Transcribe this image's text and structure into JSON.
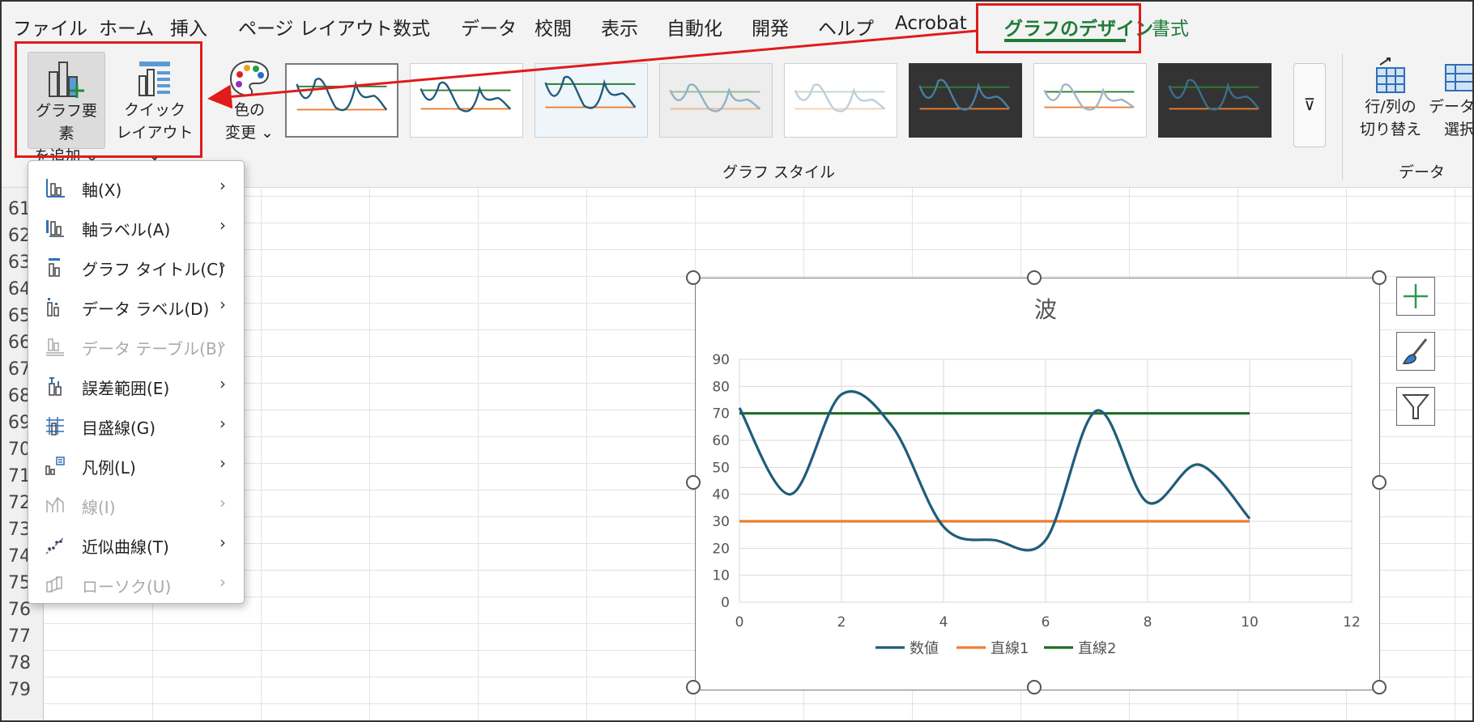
{
  "menubar": {
    "tabs": [
      {
        "label": "ファイル",
        "active": false
      },
      {
        "label": "ホーム",
        "active": false
      },
      {
        "label": "挿入",
        "active": false
      },
      {
        "label": "ページ レイアウト",
        "active": false
      },
      {
        "label": "数式",
        "active": false
      },
      {
        "label": "データ",
        "active": false
      },
      {
        "label": "校閲",
        "active": false
      },
      {
        "label": "表示",
        "active": false
      },
      {
        "label": "自動化",
        "active": false
      },
      {
        "label": "開発",
        "active": false
      },
      {
        "label": "ヘルプ",
        "active": false
      },
      {
        "label": "Acrobat",
        "active": false
      },
      {
        "label": "グラフのデザイン",
        "active": true
      },
      {
        "label": "書式",
        "active": false
      }
    ]
  },
  "ribbon": {
    "add_element": {
      "line1": "グラフ要素",
      "line2": "を追加 ⌄"
    },
    "quick_layout": {
      "line1": "クイック",
      "line2": "レイアウト ⌄"
    },
    "color": {
      "line1": "色の",
      "line2": "変更 ⌄"
    },
    "style_group_label": "グラフ スタイル",
    "switch_rowcol": {
      "line1": "行/列の",
      "line2": "切り替え"
    },
    "select_data": {
      "line1": "データの",
      "line2": "選択"
    },
    "data_group_label": "データ"
  },
  "sheet": {
    "row_numbers": [
      "61",
      "62",
      "63",
      "64",
      "65",
      "66",
      "67",
      "68",
      "69",
      "70",
      "71",
      "72",
      "73",
      "74",
      "75",
      "76",
      "77",
      "78",
      "79"
    ]
  },
  "dropdown": {
    "items": [
      {
        "label": "軸(X)",
        "icon": "axis-icon",
        "enabled": true
      },
      {
        "label": "軸ラベル(A)",
        "icon": "axis-label-icon",
        "enabled": true
      },
      {
        "label": "グラフ タイトル(C)",
        "icon": "chart-title-icon",
        "enabled": true
      },
      {
        "label": "データ ラベル(D)",
        "icon": "data-label-icon",
        "enabled": true
      },
      {
        "label": "データ テーブル(B)",
        "icon": "data-table-icon",
        "enabled": false
      },
      {
        "label": "誤差範囲(E)",
        "icon": "error-bars-icon",
        "enabled": true
      },
      {
        "label": "目盛線(G)",
        "icon": "gridlines-icon",
        "enabled": true
      },
      {
        "label": "凡例(L)",
        "icon": "legend-icon",
        "enabled": true
      },
      {
        "label": "線(I)",
        "icon": "lines-icon",
        "enabled": false
      },
      {
        "label": "近似曲線(T)",
        "icon": "trendline-icon",
        "enabled": true
      },
      {
        "label": "ローソク(U)",
        "icon": "updown-bars-icon",
        "enabled": false
      }
    ]
  },
  "chart_data": {
    "type": "scatter",
    "title": "波",
    "xlim": [
      0,
      12
    ],
    "ylim": [
      0,
      90
    ],
    "x_ticks": [
      "0",
      "2",
      "4",
      "6",
      "8",
      "10",
      "12"
    ],
    "y_ticks": [
      "0",
      "10",
      "20",
      "30",
      "40",
      "50",
      "60",
      "70",
      "80",
      "90"
    ],
    "grid": true,
    "legend_position": "bottom",
    "smooth": true,
    "series": [
      {
        "name": "数値",
        "color": "#1f5c7a",
        "x": [
          0,
          1,
          2,
          3,
          4,
          5,
          6,
          7,
          8,
          9,
          10
        ],
        "y": [
          72,
          40,
          77,
          65,
          28,
          23,
          23,
          71,
          37,
          51,
          31
        ]
      },
      {
        "name": "直線1",
        "color": "#ed7d31",
        "x": [
          0,
          10
        ],
        "y": [
          30,
          30
        ]
      },
      {
        "name": "直線2",
        "color": "#1e6b24",
        "x": [
          0,
          10
        ],
        "y": [
          70,
          70
        ]
      }
    ]
  }
}
